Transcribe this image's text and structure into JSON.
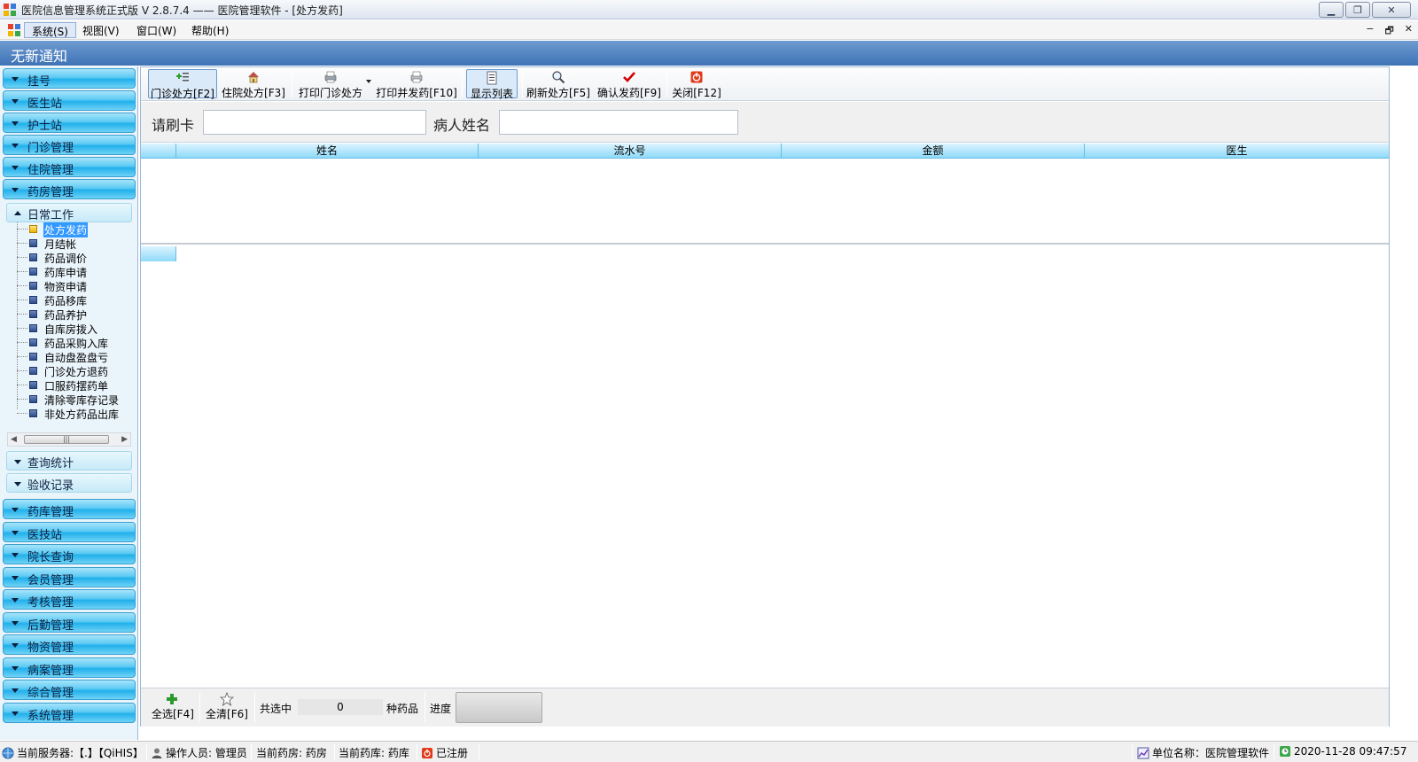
{
  "window": {
    "title": "医院信息管理系统正式版 V 2.8.7.4 —— 医院管理软件 - [处方发药]",
    "min_icon": "minimize-icon",
    "max_icon": "restore-icon",
    "close_icon": "close-icon"
  },
  "menubar": {
    "items": [
      {
        "label": "系统(S)",
        "active": true
      },
      {
        "label": "视图(V)"
      },
      {
        "label": "窗口(W)"
      },
      {
        "label": "帮助(H)"
      }
    ],
    "mdi_controls": [
      "−",
      "🗗",
      "✕"
    ]
  },
  "notice": "无新通知",
  "sidebar": {
    "top_modules": [
      "挂号",
      "医生站",
      "护士站",
      "门诊管理",
      "住院管理",
      "药房管理"
    ],
    "expanded_group": "日常工作",
    "tree_items": [
      {
        "label": "处方发药",
        "selected": true
      },
      {
        "label": "月结帐"
      },
      {
        "label": "药品调价"
      },
      {
        "label": "药库申请"
      },
      {
        "label": "物资申请"
      },
      {
        "label": "药品移库"
      },
      {
        "label": "药品养护"
      },
      {
        "label": "自库房拨入"
      },
      {
        "label": "药品采购入库"
      },
      {
        "label": "自动盘盈盘亏"
      },
      {
        "label": "门诊处方退药"
      },
      {
        "label": "口服药摆药单"
      },
      {
        "label": "清除零库存记录"
      },
      {
        "label": "非处方药品出库"
      }
    ],
    "collapsed_groups": [
      "查询统计",
      "验收记录"
    ],
    "bottom_modules": [
      "药库管理",
      "医技站",
      "院长查询",
      "会员管理",
      "考核管理",
      "后勤管理",
      "物资管理",
      "病案管理",
      "综合管理",
      "系统管理"
    ]
  },
  "toolbar": {
    "buttons": [
      {
        "label": "门诊处方[F2]",
        "icon": "add-prescription-icon",
        "pressed": true
      },
      {
        "label": "住院处方[F3]",
        "icon": "home-icon"
      },
      {
        "label": "打印门诊处方",
        "icon": "print-stack-icon",
        "dropdown": true
      },
      {
        "label": "打印并发药[F10]",
        "icon": "printer-icon"
      },
      {
        "label": "显示列表",
        "icon": "list-icon",
        "pressed": true
      },
      {
        "label": "刷新处方[F5]",
        "icon": "magnifier-icon"
      },
      {
        "label": "确认发药[F9]",
        "icon": "checkmark-icon"
      },
      {
        "label": "关闭[F12]",
        "icon": "power-icon"
      }
    ]
  },
  "filter": {
    "card_label": "请刷卡",
    "card_value": "",
    "name_label": "病人姓名",
    "name_value": ""
  },
  "grid": {
    "columns": [
      "姓名",
      "流水号",
      "金额",
      "医生"
    ],
    "rows": []
  },
  "bottombar": {
    "select_all": "全选[F4]",
    "clear_all": "全清[F6]",
    "selected_prefix": "共选中",
    "selected_count": "0",
    "selected_suffix": "种药品",
    "progress_label": "进度",
    "progress": 0
  },
  "statusbar": {
    "server": "当前服务器:【.】【QiHIS】",
    "operator": "操作人员: 管理员",
    "pharmacy": "当前药房:  药房",
    "warehouse": "当前药库:  药库",
    "registered": "已注册",
    "unit": "单位名称：医院管理软件",
    "datetime": "2020-11-28 09:47:57"
  },
  "colors": {
    "nav_button": "#21b0eb",
    "notice_bar": "#3f73b6",
    "grid_header": "#8fdaf8",
    "selection": "#3399ff",
    "confirm_check": "#d40000",
    "close_red": "#e03a1a"
  }
}
